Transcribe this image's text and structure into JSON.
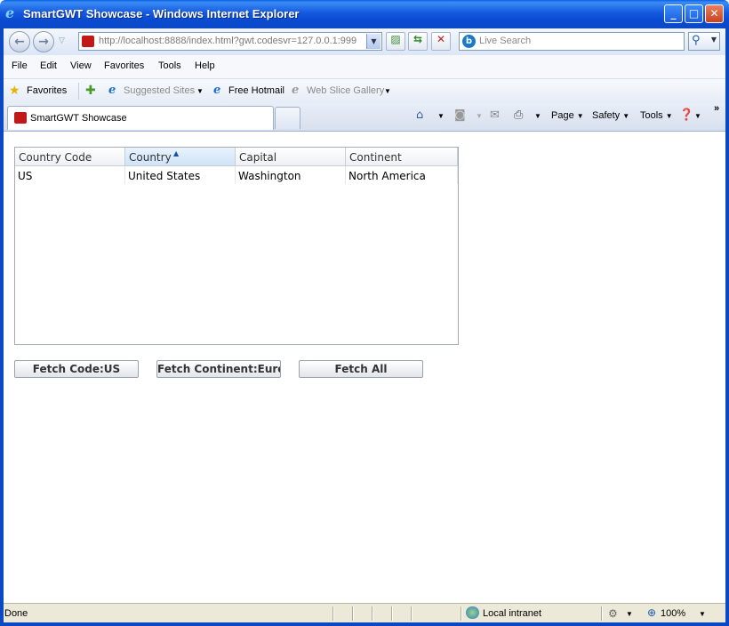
{
  "window": {
    "title": "SmartGWT Showcase - Windows Internet Explorer",
    "controls": {
      "minimize": "_",
      "maximize": "□",
      "close": "✕"
    }
  },
  "address_bar": {
    "url": "http://localhost:8888/index.html?gwt.codesvr=127.0.0.1:999",
    "search_placeholder": "Live Search",
    "icons": {
      "back": "back-arrow-icon",
      "forward": "forward-arrow-icon",
      "compat": "compatibility-view-icon",
      "refresh": "refresh-icon",
      "stop": "stop-icon",
      "search": "magnifier-icon"
    }
  },
  "menu": {
    "items": [
      "File",
      "Edit",
      "View",
      "Favorites",
      "Tools",
      "Help"
    ]
  },
  "favorites_bar": {
    "favorites_label": "Favorites",
    "suggested_sites": "Suggested Sites",
    "free_hotmail": "Free Hotmail",
    "web_slice_gallery": "Web Slice Gallery"
  },
  "tabs": {
    "active": "SmartGWT Showcase"
  },
  "command_bar": {
    "page": "Page",
    "safety": "Safety",
    "tools": "Tools",
    "more": "»"
  },
  "grid": {
    "columns": [
      "Country Code",
      "Country",
      "Capital",
      "Continent"
    ],
    "sorted_column": "Country",
    "sort_direction": "ascending",
    "rows": [
      [
        "US",
        "United States",
        "Washington",
        "North America"
      ]
    ]
  },
  "buttons": {
    "fetch_code": "Fetch Code:US",
    "fetch_continent": "Fetch Continent:Euro",
    "fetch_all": "Fetch All"
  },
  "status_bar": {
    "status": "Done",
    "zone": "Local intranet",
    "zoom": "100%"
  },
  "colors": {
    "titlebar": "#0b48c4",
    "sorted_header": "#cfe3f8"
  }
}
